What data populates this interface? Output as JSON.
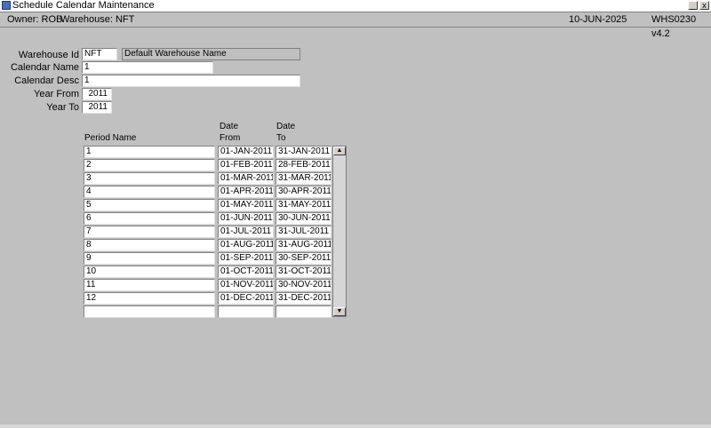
{
  "window": {
    "title": "Schedule Calendar Maintenance",
    "minimize": "_",
    "close": "x"
  },
  "infobar": {
    "owner": "Owner:  ROB",
    "warehouse": "Warehouse:  NFT",
    "date": "10-JUN-2025",
    "version": "WHS0230  v4.2"
  },
  "form": {
    "warehouse_id_label": "Warehouse Id",
    "warehouse_id": "NFT",
    "warehouse_name": "Default Warehouse Name",
    "calendar_name_label": "Calendar Name",
    "calendar_name": "1",
    "calendar_desc_label": "Calendar Desc",
    "calendar_desc": "1",
    "year_from_label": "Year From",
    "year_from": "2011",
    "year_to_label": "Year To",
    "year_to": "2011"
  },
  "table": {
    "col_period": "Period Name",
    "col_from_1": "Date",
    "col_from_2": "From",
    "col_to_1": "Date",
    "col_to_2": "To",
    "rows": [
      {
        "period": "1",
        "from": "01-JAN-2011",
        "to": "31-JAN-2011"
      },
      {
        "period": "2",
        "from": "01-FEB-2011",
        "to": "28-FEB-2011"
      },
      {
        "period": "3",
        "from": "01-MAR-2011",
        "to": "31-MAR-2011"
      },
      {
        "period": "4",
        "from": "01-APR-2011",
        "to": "30-APR-2011"
      },
      {
        "period": "5",
        "from": "01-MAY-2011",
        "to": "31-MAY-2011"
      },
      {
        "period": "6",
        "from": "01-JUN-2011",
        "to": "30-JUN-2011"
      },
      {
        "period": "7",
        "from": "01-JUL-2011",
        "to": "31-JUL-2011"
      },
      {
        "period": "8",
        "from": "01-AUG-2011",
        "to": "31-AUG-2011"
      },
      {
        "period": "9",
        "from": "01-SEP-2011",
        "to": "30-SEP-2011"
      },
      {
        "period": "10",
        "from": "01-OCT-2011",
        "to": "31-OCT-2011"
      },
      {
        "period": "11",
        "from": "01-NOV-2011",
        "to": "30-NOV-2011"
      },
      {
        "period": "12",
        "from": "01-DEC-2011",
        "to": "31-DEC-2011"
      },
      {
        "period": "",
        "from": "",
        "to": ""
      }
    ]
  },
  "scrollbar": {
    "up": "▲",
    "down": "▼"
  }
}
